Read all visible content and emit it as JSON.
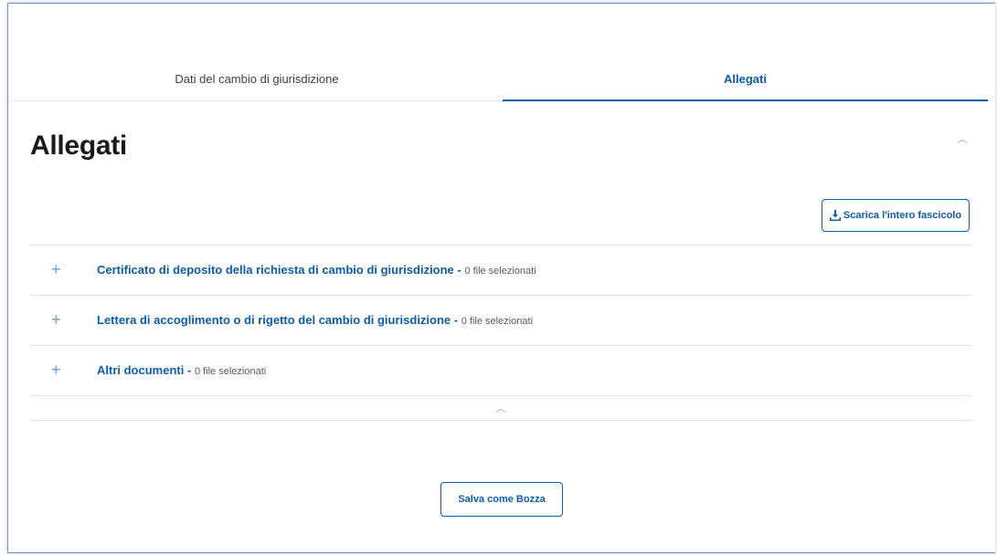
{
  "tabs": [
    {
      "label": "Dati del cambio di giurisdizione",
      "active": false
    },
    {
      "label": "Allegati",
      "active": true
    }
  ],
  "section": {
    "title": "Allegati",
    "collapse_icon": "chevron-up-icon"
  },
  "download_button": {
    "icon": "download-icon",
    "label": "Scarica l'intero fascicolo"
  },
  "accordion": {
    "separator": "-",
    "items": [
      {
        "icon": "plus-icon",
        "title": "Certificato di deposito della richiesta di cambio di giurisdizione",
        "count": "0 file selezionati"
      },
      {
        "icon": "plus-icon",
        "title": "Lettera di accoglimento o di rigetto del cambio di giurisdizione",
        "count": "0 file selezionati"
      },
      {
        "icon": "plus-icon",
        "title": "Altri documenti",
        "count": "0 file selezionati"
      }
    ],
    "footer_icon": "chevron-up-icon"
  },
  "save_button": {
    "label": "Salva come Bozza"
  },
  "colors": {
    "accent": "#0b5cab",
    "frame_border": "#6a8fd8",
    "divider": "#dfe3e7"
  }
}
